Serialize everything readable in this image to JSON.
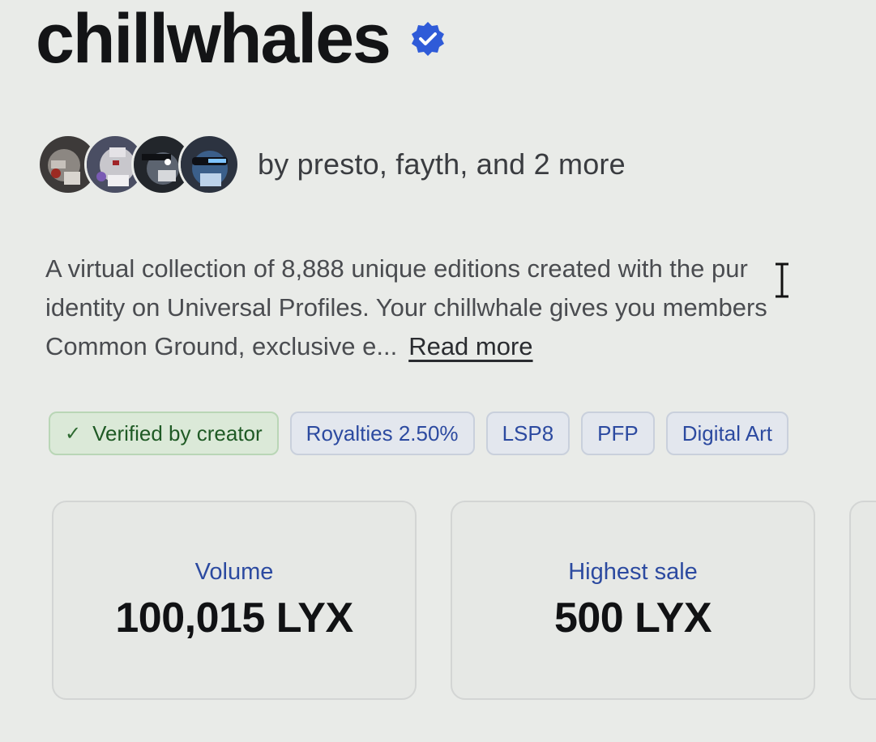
{
  "collection": {
    "title": "chillwhales",
    "verified_icon": "verified-check-icon",
    "byline": "by presto, fayth, and 2 more",
    "avatars": [
      "creator-avatar-1",
      "creator-avatar-2",
      "creator-avatar-3",
      "creator-avatar-4"
    ],
    "description_lines": [
      "A virtual collection of 8,888 unique editions created with the pur",
      "identity on Universal Profiles. Your chillwhale gives you members",
      "Common Ground, exclusive e..."
    ],
    "read_more_label": "Read more"
  },
  "tags": {
    "verified": {
      "icon": "checkmark-icon",
      "label": "Verified by creator"
    },
    "royalties": "Royalties 2.50%",
    "standard": "LSP8",
    "pfp": "PFP",
    "category": "Digital Art"
  },
  "stats": {
    "volume": {
      "label": "Volume",
      "value": "100,015 LYX"
    },
    "highest_sale": {
      "label": "Highest sale",
      "value": "500 LYX"
    }
  },
  "colors": {
    "accent_blue": "#2c4aa0",
    "verified_badge": "#2f5bd8",
    "tag_green_text": "#1f5a25",
    "background": "#e9ebe8"
  }
}
